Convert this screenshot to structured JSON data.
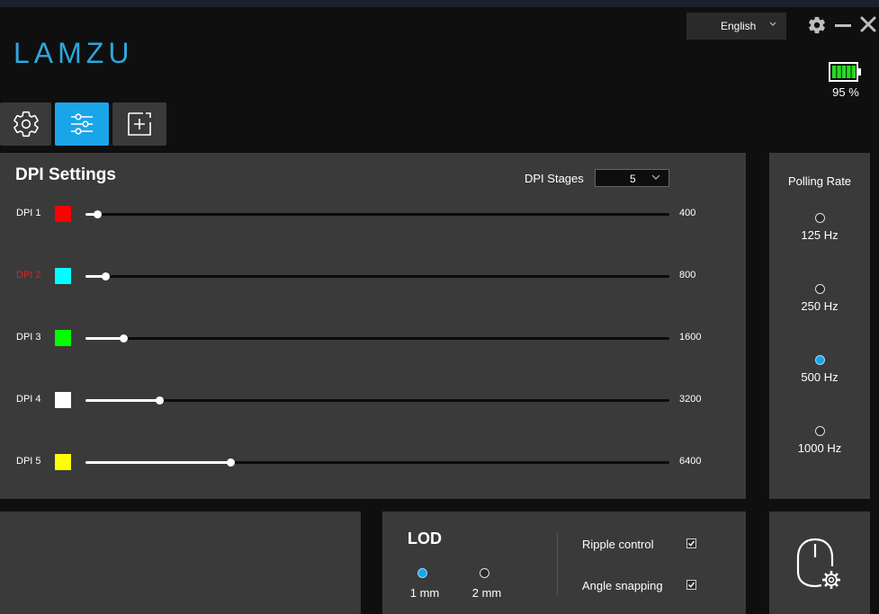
{
  "app": {
    "logo_text": "LAMZU"
  },
  "header": {
    "language": "English",
    "battery_percent": 95,
    "battery_text": "95 %",
    "icons": [
      "gear-icon",
      "minimize-icon",
      "close-icon",
      "battery-icon"
    ]
  },
  "tabs": [
    {
      "icon": "gear-icon",
      "active": false
    },
    {
      "icon": "sliders-icon",
      "active": true
    },
    {
      "icon": "macro-plus-icon",
      "active": false
    }
  ],
  "dpi": {
    "title": "DPI Settings",
    "stages_label": "DPI Stages",
    "stages_value": "5",
    "max": 26000,
    "rows": [
      {
        "label": "DPI 1",
        "value": "400",
        "color": "#ff0000",
        "fill": 0.02,
        "selected": false
      },
      {
        "label": "DPI 2",
        "value": "800",
        "color": "#00ffff",
        "fill": 0.034,
        "selected": true
      },
      {
        "label": "DPI 3",
        "value": "1600",
        "color": "#00ff00",
        "fill": 0.065,
        "selected": false
      },
      {
        "label": "DPI 4",
        "value": "3200",
        "color": "#ffffff",
        "fill": 0.126,
        "selected": false
      },
      {
        "label": "DPI 5",
        "value": "6400",
        "color": "#ffff00",
        "fill": 0.248,
        "selected": false
      }
    ]
  },
  "polling": {
    "title": "Polling Rate",
    "options": [
      {
        "label": "125 Hz",
        "checked": false
      },
      {
        "label": "250 Hz",
        "checked": false
      },
      {
        "label": "500 Hz",
        "checked": true
      },
      {
        "label": "1000 Hz",
        "checked": false
      }
    ]
  },
  "lod": {
    "title": "LOD",
    "options": [
      {
        "label": "1 mm",
        "checked": true
      },
      {
        "label": "2 mm",
        "checked": false
      }
    ],
    "ripple_label": "Ripple control",
    "ripple_checked": true,
    "angle_label": "Angle snapping",
    "angle_checked": true
  },
  "colors": {
    "accent": "#1aa5e8",
    "panel": "#3a3a3a",
    "background": "#0f0f0f",
    "selected_dpi": "#e02020"
  }
}
